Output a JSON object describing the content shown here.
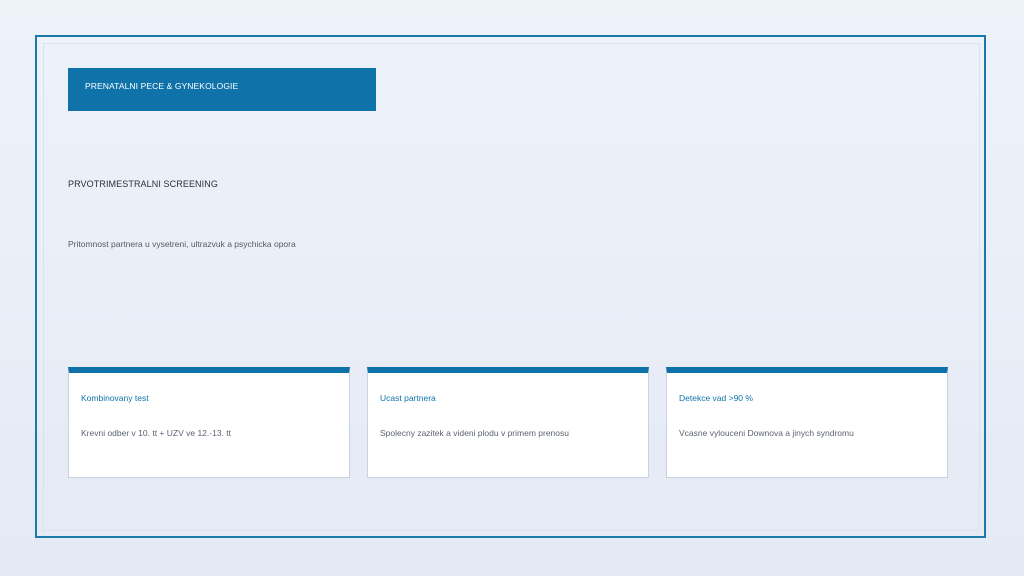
{
  "header": {
    "label": "PRENATALNI PECE & GYNEKOLOGIE"
  },
  "main": {
    "title": "PRVOTRIMESTRALNI SCREENING",
    "subtitle": "Pritomnost partnera u vysetreni, ultrazvuk a psychicka opora"
  },
  "cards": [
    {
      "title": "Kombinovany test",
      "text": "Krevni odber v 10. tt + UZV ve 12.-13. tt"
    },
    {
      "title": "Ucast partnera",
      "text": "Spolecny zazitek a videni plodu v primem prenosu"
    },
    {
      "title": "Detekce vad >90 %",
      "text": "Vcasne vylouceni Downova a jinych syndromu"
    }
  ],
  "colors": {
    "accent": "#0f73aa",
    "border": "#1a79a8",
    "background": "#eaeff7"
  }
}
